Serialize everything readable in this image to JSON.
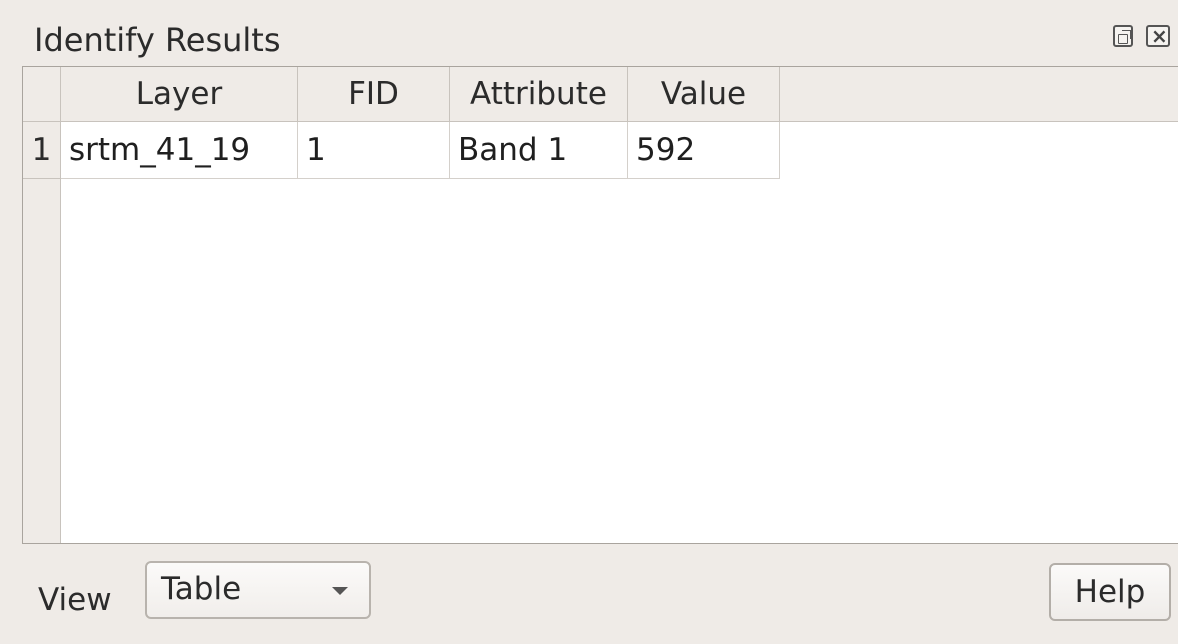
{
  "panel": {
    "title": "Identify Results"
  },
  "table": {
    "columns": [
      "Layer",
      "FID",
      "Attribute",
      "Value"
    ],
    "rows": [
      {
        "index": "1",
        "layer": "srtm_41_19",
        "fid": "1",
        "attribute": "Band 1",
        "value": "592"
      }
    ]
  },
  "footer": {
    "view_label": "View",
    "view_selected": "Table",
    "help_label": "Help"
  },
  "icons": {
    "float": "float-icon",
    "close": "close-icon",
    "dropdown": "chevron-down-icon"
  }
}
